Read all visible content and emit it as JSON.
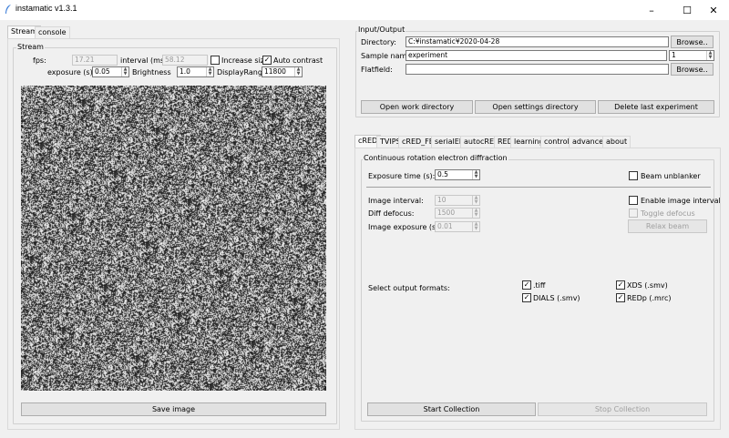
{
  "window": {
    "title": "instamatic v1.3.1",
    "minimize": "–",
    "maximize": "☐",
    "close": "✕"
  },
  "left": {
    "tabs": [
      {
        "label": "Stream",
        "active": true
      },
      {
        "label": "console",
        "active": false
      }
    ],
    "stream": {
      "group_label": "Stream",
      "fps_label": "fps:",
      "fps_value": "17.21",
      "interval_label": "interval (ms):",
      "interval_value": "58.12",
      "increase_size_label": "Increase size",
      "increase_size_checked": false,
      "auto_contrast_label": "Auto contrast",
      "auto_contrast_checked": true,
      "exposure_label": "exposure (s)",
      "exposure_value": "0.05",
      "brightness_label": "Brightness",
      "brightness_value": "1.0",
      "display_range_label": "DisplayRange",
      "display_range_value": "11800",
      "save_image_label": "Save image"
    }
  },
  "io": {
    "group_label": "Input/Output",
    "directory_label": "Directory:",
    "directory_value": "C:¥instamatic¥2020-04-28",
    "browse_label": "Browse..",
    "sample_name_label": "Sample name:",
    "sample_name_value": "experiment",
    "sample_number_value": "1",
    "flatfield_label": "Flatfield:",
    "flatfield_value": "",
    "flatfield_browse_label": "Browse..",
    "open_work_dir_label": "Open work directory",
    "open_settings_dir_label": "Open settings directory",
    "delete_last_label": "Delete last experiment"
  },
  "right_tabs": [
    {
      "label": "cRED",
      "active": true
    },
    {
      "label": "TVIPS",
      "active": false
    },
    {
      "label": "cRED_FEI",
      "active": false
    },
    {
      "label": "serialED",
      "active": false
    },
    {
      "label": "autocRED",
      "active": false
    },
    {
      "label": "RED",
      "active": false
    },
    {
      "label": "learning",
      "active": false
    },
    {
      "label": "control",
      "active": false
    },
    {
      "label": "advanced",
      "active": false
    },
    {
      "label": "about",
      "active": false
    }
  ],
  "cred": {
    "group_label": "Continuous rotation electron diffraction",
    "exposure_time_label": "Exposure time (s):",
    "exposure_time_value": "0.5",
    "beam_unblanker_label": "Beam unblanker",
    "beam_unblanker_checked": false,
    "image_interval_label": "Image interval:",
    "image_interval_value": "10",
    "diff_defocus_label": "Diff defocus:",
    "diff_defocus_value": "1500",
    "image_exposure_label": "Image exposure (s):",
    "image_exposure_value": "0.01",
    "enable_image_interval_label": "Enable image interval",
    "enable_image_interval_checked": false,
    "toggle_defocus_label": "Toggle defocus",
    "toggle_defocus_checked": false,
    "relax_beam_label": "Relax beam",
    "select_output_label": "Select output formats:",
    "formats": {
      "tiff": {
        "label": ".tiff",
        "checked": true
      },
      "xds": {
        "label": "XDS (.smv)",
        "checked": true
      },
      "dials": {
        "label": "DIALS (.smv)",
        "checked": true
      },
      "redp": {
        "label": "REDp (.mrc)",
        "checked": true
      }
    },
    "start_collection_label": "Start Collection",
    "stop_collection_label": "Stop Collection"
  },
  "icons": {
    "check": "✓",
    "spin_up": "▲",
    "spin_down": "▼"
  }
}
